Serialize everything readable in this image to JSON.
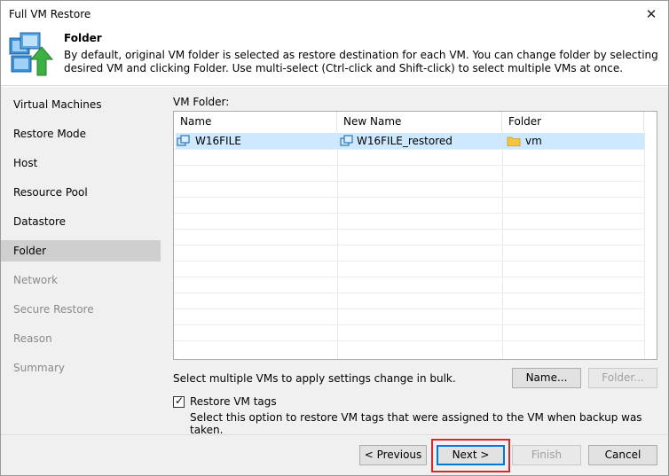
{
  "window": {
    "title": "Full VM Restore",
    "close_glyph": "✕"
  },
  "header": {
    "title": "Folder",
    "description": "By default, original VM folder is selected as restore destination for each VM. You can change folder by selecting desired VM and clicking Folder. Use multi-select (Ctrl-click and Shift-click) to select multiple VMs at once.",
    "icon": "restore-vm-icon"
  },
  "sidebar": {
    "items": [
      {
        "label": "Virtual Machines",
        "state": "normal"
      },
      {
        "label": "Restore Mode",
        "state": "normal"
      },
      {
        "label": "Host",
        "state": "normal"
      },
      {
        "label": "Resource Pool",
        "state": "normal"
      },
      {
        "label": "Datastore",
        "state": "normal"
      },
      {
        "label": "Folder",
        "state": "active"
      },
      {
        "label": "Network",
        "state": "disabled"
      },
      {
        "label": "Secure Restore",
        "state": "disabled"
      },
      {
        "label": "Reason",
        "state": "disabled"
      },
      {
        "label": "Summary",
        "state": "disabled"
      }
    ]
  },
  "vm_folder": {
    "label": "VM Folder:",
    "columns": [
      "Name",
      "New Name",
      "Folder"
    ],
    "rows": [
      {
        "name": "W16FILE",
        "new_name": "W16FILE_restored",
        "folder": "vm",
        "selected": true
      }
    ]
  },
  "bulk": {
    "text": "Select multiple VMs to apply settings change in bulk.",
    "name_button": "Name...",
    "folder_button": "Folder..."
  },
  "restore_tags": {
    "checked": true,
    "check_glyph": "✓",
    "label": "Restore VM tags",
    "description": "Select this option to restore VM tags that were assigned to the VM when backup was taken."
  },
  "footer": {
    "previous": "< Previous",
    "next": "Next >",
    "finish": "Finish",
    "cancel": "Cancel"
  },
  "colors": {
    "selection": "#cde8ff",
    "active_nav": "#cfcfcf",
    "highlight": "#d9262f",
    "accent": "#0078d7"
  }
}
